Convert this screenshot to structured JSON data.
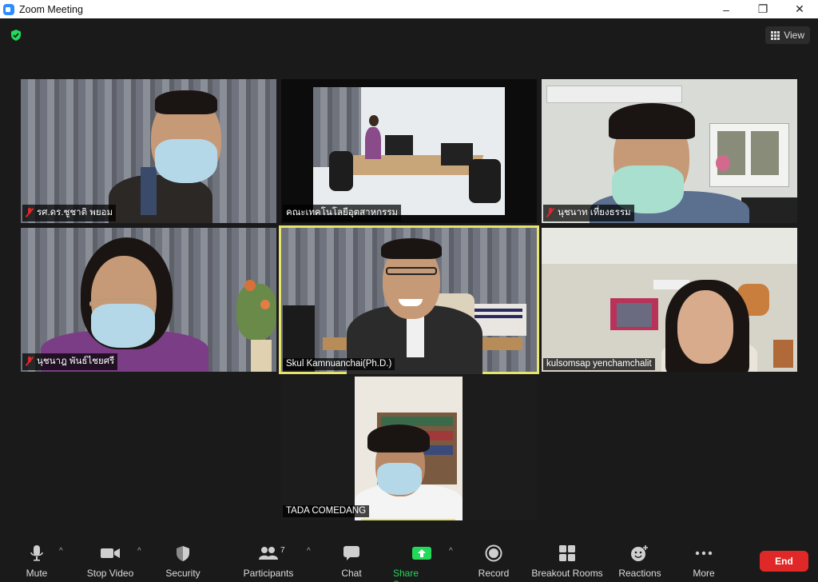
{
  "window": {
    "title": "Zoom Meeting",
    "controls": [
      "–",
      "❐",
      "✕"
    ]
  },
  "topbar": {
    "view_label": "View"
  },
  "participants": [
    {
      "name": "รศ.ดร.ชูชาติ  พยอม",
      "muted": true
    },
    {
      "name": "คณะเทคโนโลยีอุตสาหกรรม",
      "muted": false
    },
    {
      "name": "นุชนาท  เที่ยงธรรม",
      "muted": true
    },
    {
      "name": "นุชนาฎ  พันธ์ไชยศรี",
      "muted": true
    },
    {
      "name": "Skul Kamnuanchai(Ph.D.)",
      "muted": false,
      "active_speaker": true
    },
    {
      "name": "kulsomsap yenchamchalit",
      "muted": false
    },
    {
      "name": "TADA COMEDANG",
      "muted": false
    }
  ],
  "toolbar": {
    "mute": "Mute",
    "stop_video": "Stop Video",
    "security": "Security",
    "participants": "Participants",
    "participants_count": "7",
    "chat": "Chat",
    "share_screen": "Share Screen",
    "record": "Record",
    "breakout_rooms": "Breakout Rooms",
    "reactions": "Reactions",
    "more": "More",
    "end": "End"
  },
  "colors": {
    "accent_blue": "#2d8cff",
    "share_green": "#23d959",
    "end_red": "#e02828",
    "active_speaker_border": "#e6e36e",
    "shield_green": "#23d959"
  },
  "icons": [
    "zoom-app-icon",
    "shield-icon",
    "grid-icon",
    "microphone-icon",
    "video-camera-icon",
    "security-shield-icon",
    "participants-icon",
    "chat-icon",
    "share-screen-icon",
    "record-icon",
    "breakout-rooms-icon",
    "reactions-icon",
    "more-icon",
    "muted-mic-icon"
  ]
}
